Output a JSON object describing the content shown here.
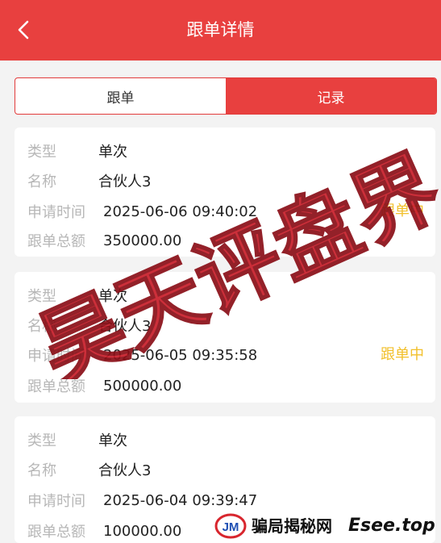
{
  "header": {
    "title": "跟单详情"
  },
  "tabs": [
    {
      "label": "跟单"
    },
    {
      "label": "记录"
    }
  ],
  "labels": {
    "type": "类型",
    "name": "名称",
    "time": "申请时间",
    "amount": "跟单总额"
  },
  "records": [
    {
      "type": "单次",
      "name": "合伙人3",
      "time": "2025-06-06 09:40:02",
      "amount": "350000.00",
      "status": "跟单中"
    },
    {
      "type": "单次",
      "name": "合伙人3",
      "time": "2025-06-05 09:35:58",
      "amount": "500000.00",
      "status": "跟单中"
    },
    {
      "type": "单次",
      "name": "合伙人3",
      "time": "2025-06-04 09:39:47",
      "amount": "100000.00",
      "status": ""
    }
  ],
  "watermark": {
    "text": "昊天评盘界"
  },
  "footer": {
    "text": "骗局揭秘网",
    "site": "Esee.top"
  },
  "colors": {
    "accent": "#e8403f",
    "status": "#f2c02c",
    "watermark": "#c81e2a"
  },
  "icons": {
    "back": "chevron-left-icon",
    "logo": "jm-logo-icon"
  }
}
